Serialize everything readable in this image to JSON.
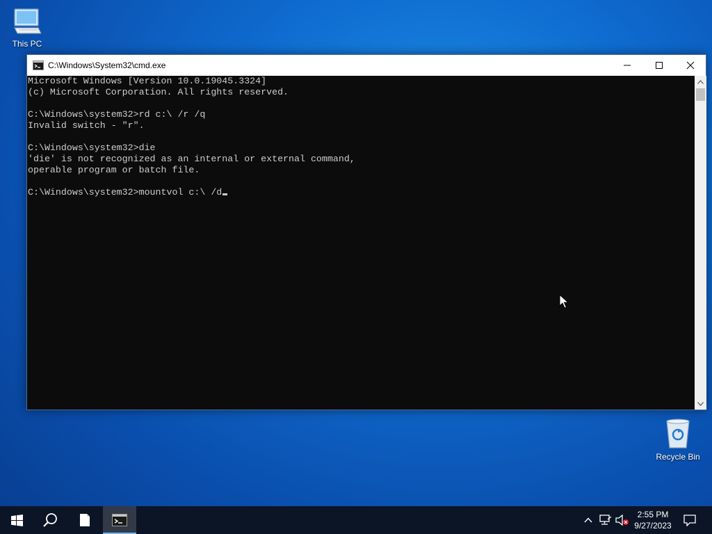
{
  "desktop": {
    "icons": [
      {
        "label": "This PC"
      },
      {
        "label": "Recycle Bin"
      }
    ]
  },
  "window": {
    "title": "C:\\Windows\\System32\\cmd.exe"
  },
  "console": {
    "lines": [
      "Microsoft Windows [Version 10.0.19045.3324]",
      "(c) Microsoft Corporation. All rights reserved.",
      "",
      "C:\\Windows\\system32>rd c:\\ /r /q",
      "Invalid switch - \"r\".",
      "",
      "C:\\Windows\\system32>die",
      "'die' is not recognized as an internal or external command,",
      "operable program or batch file.",
      "",
      "C:\\Windows\\system32>mountvol c:\\ /d"
    ]
  },
  "taskbar": {
    "time": "2:55 PM",
    "date": "9/27/2023"
  },
  "colors": {
    "console_bg": "#0c0c0c",
    "console_text": "#cccccc",
    "taskbar_bg": "#0b1526",
    "accent": "#76b9ed"
  }
}
